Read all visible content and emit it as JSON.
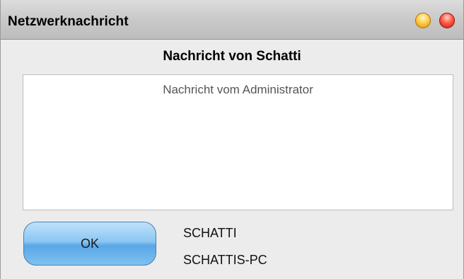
{
  "window": {
    "title": "Netzwerknachricht"
  },
  "dialog": {
    "heading": "Nachricht von Schatti",
    "message": "Nachricht vom Administrator",
    "ok_label": "OK",
    "sender_user": "SCHATTI",
    "sender_host": "SCHATTIS-PC"
  },
  "colors": {
    "minimize": "#ffcf4a",
    "close": "#ff5a45",
    "ok_button": "#8cc6f2"
  }
}
